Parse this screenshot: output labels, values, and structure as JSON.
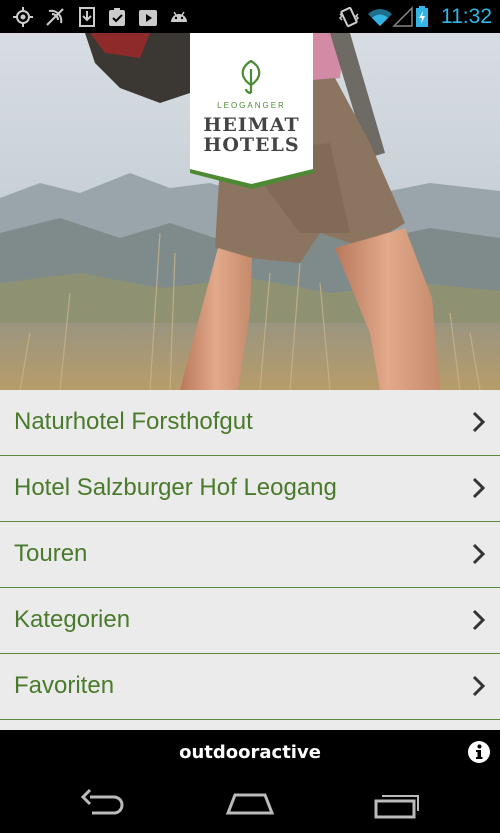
{
  "status_bar": {
    "time": "11:32",
    "left_icons": [
      "gps-icon",
      "nfc-icon",
      "download-icon",
      "clipboard-check-icon",
      "play-store-icon",
      "android-icon"
    ],
    "right_icons": [
      "vibrate-icon",
      "wifi-icon",
      "signal-icon",
      "battery-charging-icon"
    ],
    "time_color": "#33b5e5"
  },
  "logo": {
    "small_text": "LEOGANGER",
    "line1": "HEIMAT",
    "line2": "HOTELS",
    "accent_color": "#4e8a34"
  },
  "menu": {
    "items": [
      {
        "label": "Naturhotel Forsthofgut"
      },
      {
        "label": "Hotel Salzburger Hof Leogang"
      },
      {
        "label": "Touren"
      },
      {
        "label": "Kategorien"
      },
      {
        "label": "Favoriten"
      }
    ],
    "text_color": "#4a7a2c"
  },
  "footer": {
    "brand": "outdooractive",
    "info_icon": "info-icon"
  },
  "nav_bar": {
    "icons": [
      "back-icon",
      "home-icon",
      "recent-apps-icon"
    ]
  }
}
